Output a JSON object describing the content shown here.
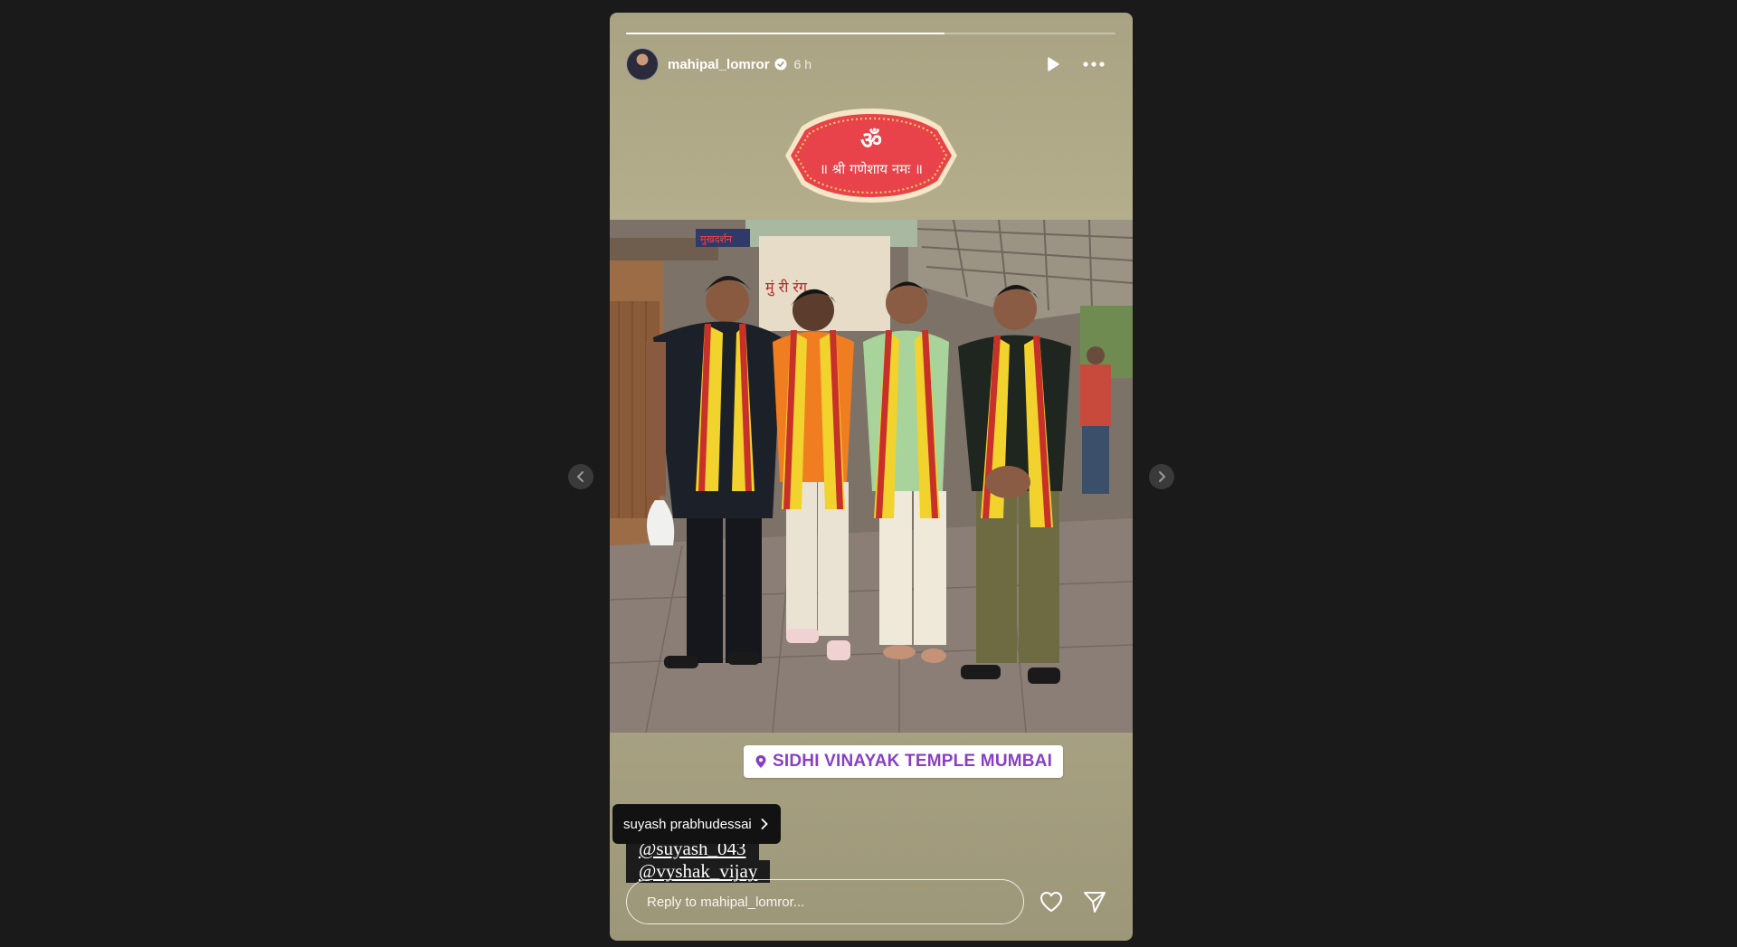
{
  "story": {
    "username": "mahipal_lomror",
    "time_ago": "6 h",
    "progress": 0.65,
    "verified_icon": "verified-badge-icon",
    "play_icon": "play-icon",
    "more_icon": "more-options-icon",
    "sticker_text_top": "ॐ",
    "sticker_text_bottom": "॥ श्री गणेशाय नमः ॥",
    "location": "SIDHI VINAYAK TEMPLE MUMBAI",
    "tag_tooltip": "suyash prabhudessai",
    "mentions": [
      "@suyash_043",
      "@vyshak_vijay"
    ],
    "reply_placeholder": "Reply to mahipal_lomror..."
  },
  "photo_sign": {
    "board_text": "मुं          री रंग",
    "red_sign": "मुखदर्शन"
  },
  "colors": {
    "background": "#1a1a1a",
    "story_bg": "#b5af8d",
    "location_text": "#8a3fc7",
    "sticker_red": "#e8434a",
    "sticker_border": "#f5e7c6"
  }
}
